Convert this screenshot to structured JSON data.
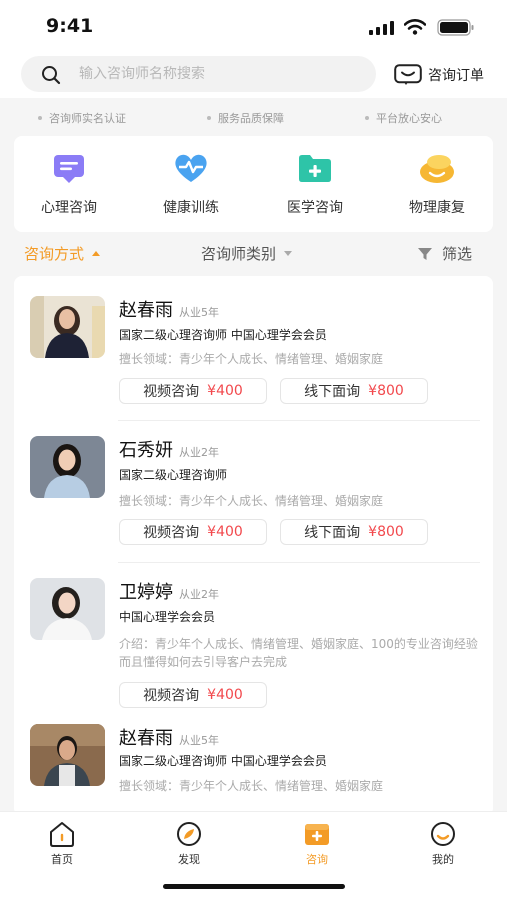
{
  "status": {
    "time": "9:41"
  },
  "search": {
    "placeholder": "输入咨询师名称搜索",
    "orders_label": "咨询订单"
  },
  "guarantees": [
    "咨询师实名认证",
    "服务品质保障",
    "平台放心安心"
  ],
  "categories": [
    {
      "label": "心理咨询",
      "icon": "chat-icon",
      "color": "#8b7cf6"
    },
    {
      "label": "健康训练",
      "icon": "heart-pulse-icon",
      "color": "#4aa3f0"
    },
    {
      "label": "医学咨询",
      "icon": "medical-folder-icon",
      "color": "#2ec4a8"
    },
    {
      "label": "物理康复",
      "icon": "rehab-icon",
      "color": "#f6b733"
    }
  ],
  "filters": {
    "mode": "咨询方式",
    "type": "咨询师类别",
    "filter": "筛选"
  },
  "counselors": [
    {
      "name": "赵春雨",
      "years": "从业5年",
      "creds": "国家二级心理咨询师   中国心理学会会员",
      "desc": "擅长领域：青少年个人成长、情绪管理、婚姻家庭",
      "prices": [
        {
          "label": "视频咨询",
          "amount": "¥400"
        },
        {
          "label": "线下面询",
          "amount": "¥800"
        }
      ]
    },
    {
      "name": "石秀妍",
      "years": "从业2年",
      "creds": "国家二级心理咨询师",
      "desc": "擅长领域：青少年个人成长、情绪管理、婚姻家庭",
      "prices": [
        {
          "label": "视频咨询",
          "amount": "¥400"
        },
        {
          "label": "线下面询",
          "amount": "¥800"
        }
      ]
    },
    {
      "name": "卫婷婷",
      "years": "从业2年",
      "creds": "中国心理学会会员",
      "desc": "介绍：青少年个人成长、情绪管理、婚姻家庭、100的专业咨询经验而且懂得如何去引导客户去完成",
      "prices": [
        {
          "label": "视频咨询",
          "amount": "¥400"
        }
      ]
    },
    {
      "name": "赵春雨",
      "years": "从业5年",
      "creds": "国家二级心理咨询师   中国心理学会会员",
      "desc": "擅长领域：青少年个人成长、情绪管理、婚姻家庭",
      "prices": []
    }
  ],
  "tabs": [
    {
      "label": "首页",
      "icon": "home-icon"
    },
    {
      "label": "发现",
      "icon": "compass-icon"
    },
    {
      "label": "咨询",
      "icon": "consult-icon"
    },
    {
      "label": "我的",
      "icon": "profile-icon"
    }
  ],
  "colors": {
    "accent": "#f39b26",
    "price": "#f2494d"
  }
}
